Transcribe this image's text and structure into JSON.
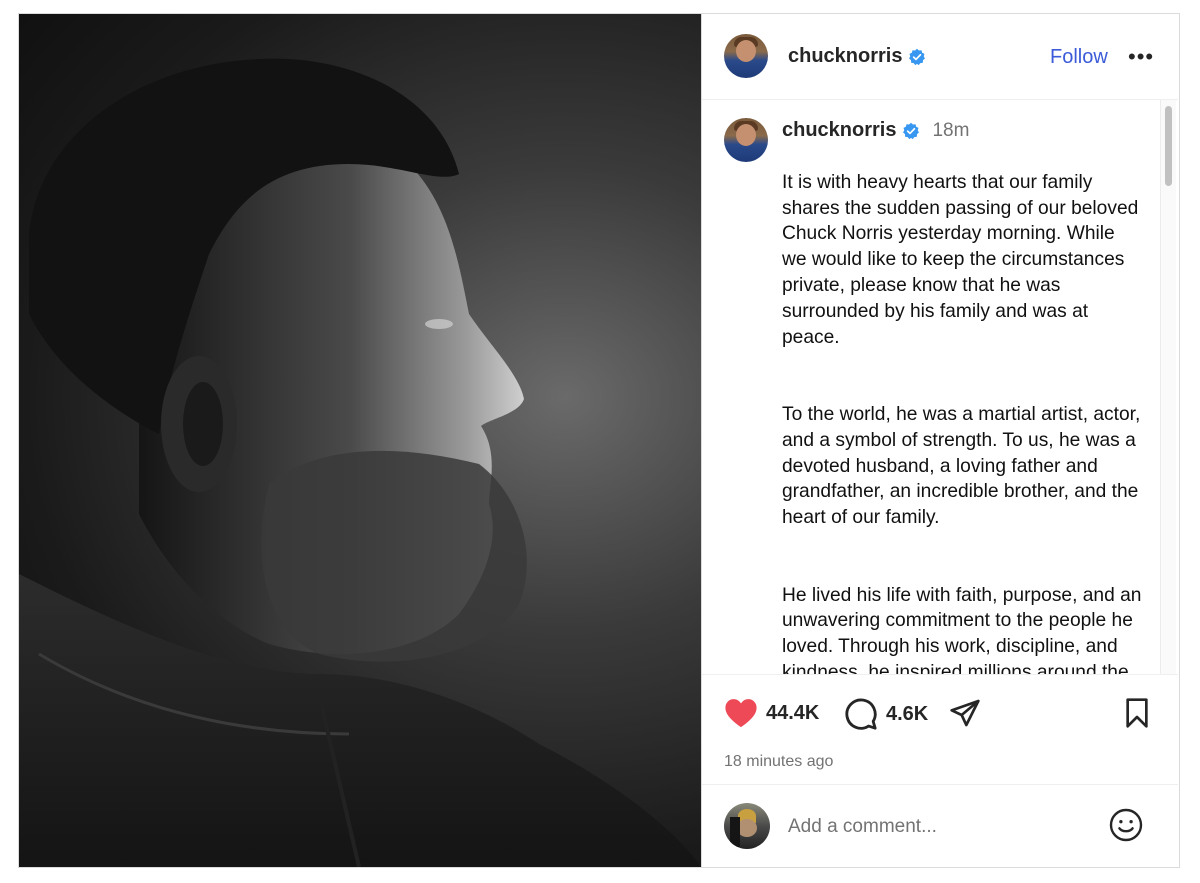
{
  "post": {
    "username": "chucknorris",
    "verified": true,
    "follow_label": "Follow",
    "more_label": "•••",
    "time_short": "18m",
    "caption_p1": "It is with heavy hearts that our family shares the sudden passing of our beloved Chuck Norris yesterday morning. While we would like to keep the circumstances private, please know that he was surrounded by his family and was at peace.",
    "caption_p2": "To the world, he was a martial artist, actor, and a symbol of strength. To us, he was a devoted husband, a loving father and grandfather, an incredible brother, and the heart of our family.",
    "caption_p3": "He lived his life with faith, purpose, and an unwavering commitment to the people he loved. Through his work, discipline, and kindness, he inspired millions around the world and left a lasting impact on so many lives.",
    "likes": "44.4K",
    "comments": "4.6K",
    "timestamp": "18 minutes ago",
    "comment_placeholder": "Add a comment..."
  },
  "colors": {
    "accent": "#3b5bd9",
    "like": "#ed4956",
    "verified": "#3897f0"
  },
  "icons": {
    "like": "heart-filled-icon",
    "comment": "comment-bubble-icon",
    "share": "send-icon",
    "save": "bookmark-icon",
    "emoji": "smiley-icon",
    "verified": "verified-badge-icon"
  }
}
